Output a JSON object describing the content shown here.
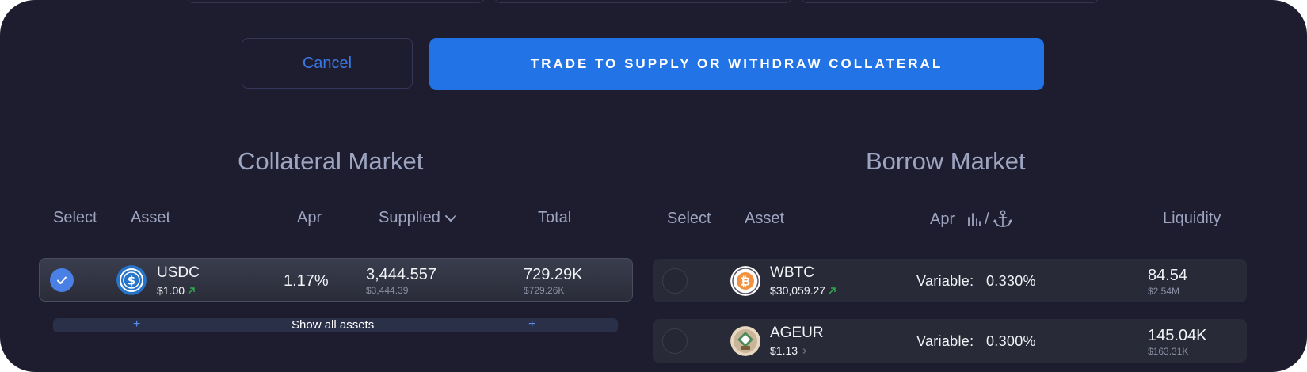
{
  "actions": {
    "cancel_label": "Cancel",
    "trade_label": "TRADE TO SUPPLY OR WITHDRAW COLLATERAL"
  },
  "collateral": {
    "title": "Collateral Market",
    "headers": {
      "select": "Select",
      "asset": "Asset",
      "apr": "Apr",
      "supplied": "Supplied",
      "total": "Total"
    },
    "sort_icon": "chevron-down-icon",
    "rows": [
      {
        "selected": true,
        "symbol": "USDC",
        "price": "$1.00",
        "trend": "up",
        "apr": "1.17%",
        "supplied": "3,444.557",
        "supplied_usd": "$3,444.39",
        "total": "729.29K",
        "total_usd": "$729.26K",
        "icon": "usdc-coin-icon"
      }
    ],
    "show_all_label": "Show all assets",
    "plus_glyph": "+"
  },
  "borrow": {
    "title": "Borrow Market",
    "headers": {
      "select": "Select",
      "asset": "Asset",
      "apr": "Apr",
      "apr_separator": "/",
      "liquidity": "Liquidity"
    },
    "header_icons": [
      "bar-chart-icon",
      "anchor-icon"
    ],
    "rows": [
      {
        "symbol": "WBTC",
        "price": "$30,059.27",
        "trend": "up",
        "rate_label": "Variable:",
        "rate": "0.330%",
        "liquidity": "84.54",
        "liquidity_usd": "$2.54M",
        "icon": "wbtc-coin-icon"
      },
      {
        "symbol": "AGEUR",
        "price": "$1.13",
        "trend": "neutral",
        "rate_label": "Variable:",
        "rate": "0.300%",
        "liquidity": "145.04K",
        "liquidity_usd": "$163.31K",
        "icon": "ageur-coin-icon"
      }
    ]
  },
  "colors": {
    "background": "#1e1d30",
    "accent": "#2173e6",
    "trend_up": "#2fa84f"
  }
}
